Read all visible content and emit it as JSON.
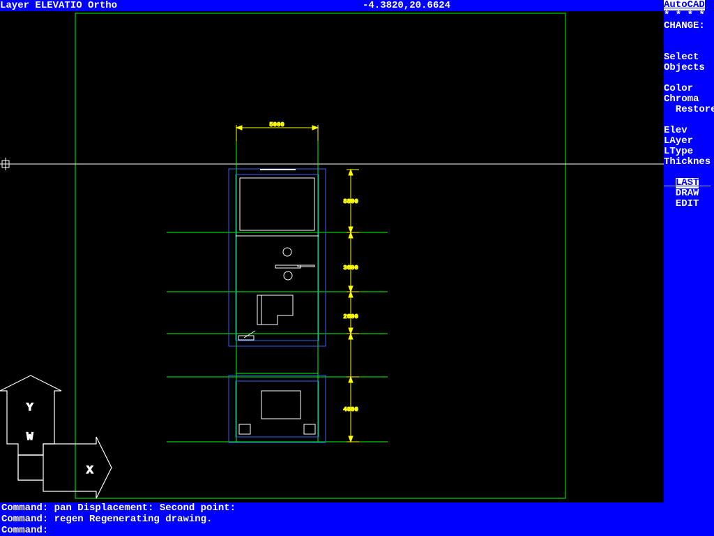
{
  "status": {
    "layer_label": "Layer",
    "layer_name": "ELEVATIO",
    "mode": "Ortho",
    "coords": "-4.3820,20.6624"
  },
  "menu": {
    "title": "AutoCAD",
    "stars": "* * * *",
    "change": "CHANGE:",
    "select": "Select",
    "objects": "Objects",
    "color": "Color",
    "chroma": "Chroma",
    "restore": "  Restore",
    "elev": "Elev",
    "layer": "LAyer",
    "ltype": "LType",
    "thicknes": "Thicknes",
    "last_pre": "__",
    "last": "LAST",
    "last_post": "__",
    "draw": "  DRAW",
    "edit": "  EDIT"
  },
  "dimensions": {
    "top": "5000",
    "r1": "8800",
    "r2": "3600",
    "r3": "2600",
    "r4": "4000"
  },
  "ucs": {
    "x": "X",
    "y": "Y",
    "w": "W"
  },
  "commands": {
    "l1": "Command: pan Displacement:  Second point:",
    "l2": "Command: regen Regenerating drawing.",
    "l3": "Command:"
  },
  "colors": {
    "bg": "#000000",
    "blue": "#0000ff",
    "green": "#00ff00",
    "bright_blue": "#3064ff",
    "yellow": "#ffff00",
    "white": "#ffffff"
  }
}
